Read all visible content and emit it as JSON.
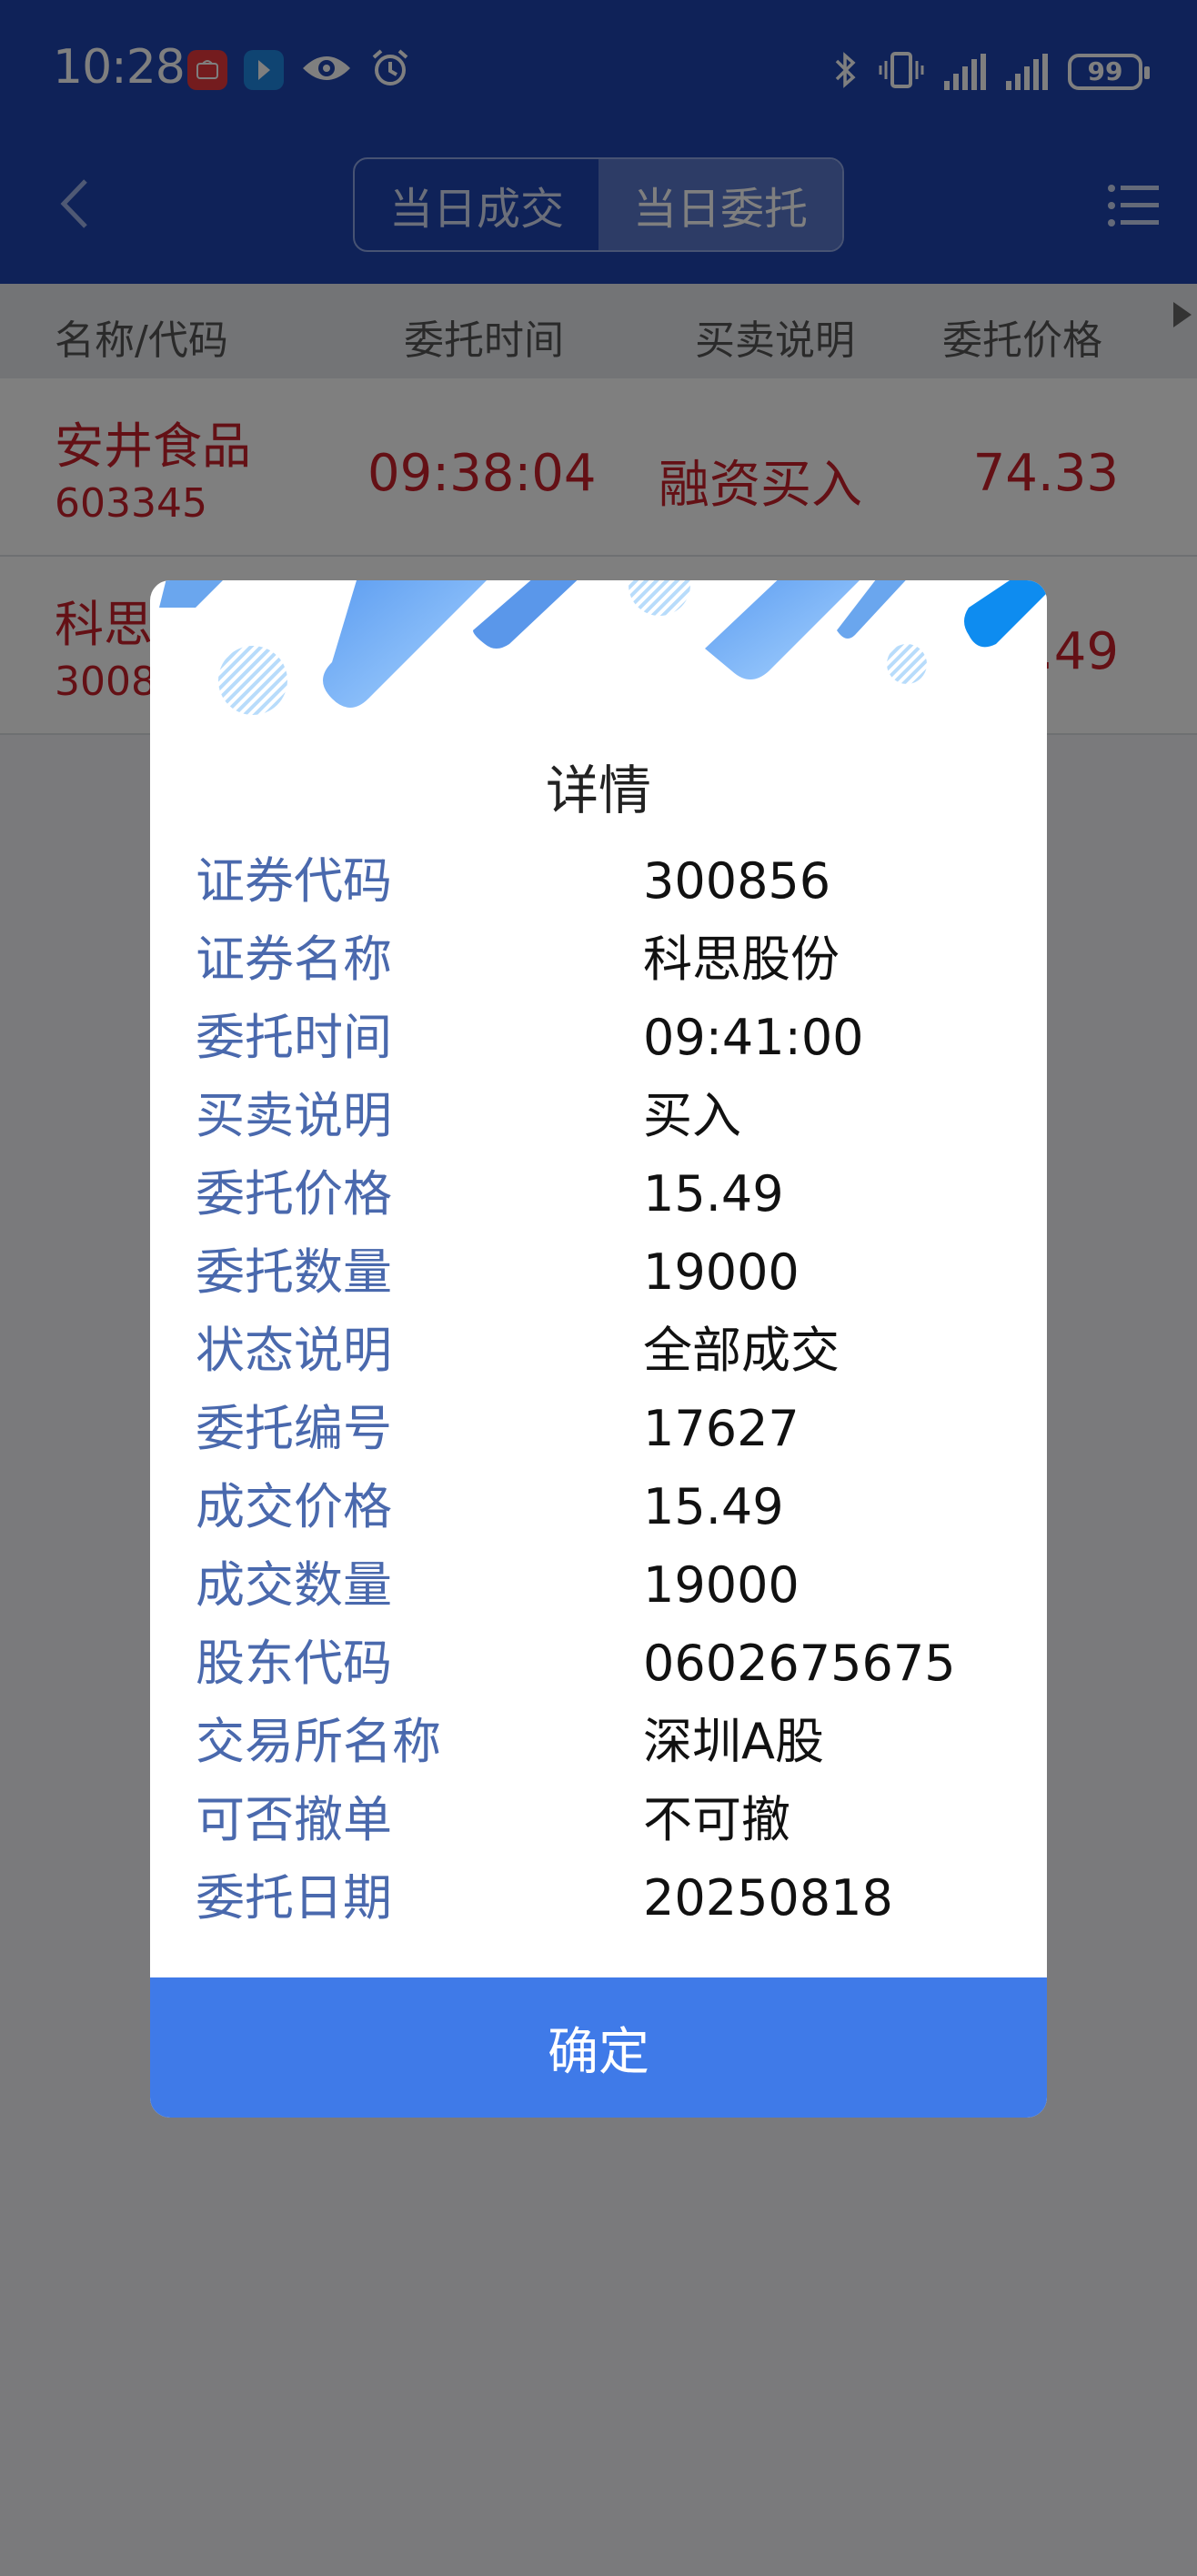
{
  "status_bar": {
    "time": "10:28",
    "battery": "99",
    "icons": [
      "huawei-app-icon",
      "arrow-app-icon",
      "eye-icon",
      "alarm-icon",
      "bluetooth-icon",
      "vibrate-icon",
      "signal-icon",
      "signal-icon"
    ]
  },
  "nav": {
    "tabs": [
      {
        "label": "当日成交",
        "active": false
      },
      {
        "label": "当日委托",
        "active": true
      }
    ]
  },
  "table": {
    "columns": [
      "名称/代码",
      "委托时间",
      "买卖说明",
      "委托价格"
    ],
    "rows": [
      {
        "name": "安井食品",
        "code": "603345",
        "time": "09:38:04",
        "note": "融资买入",
        "price": "74.33"
      },
      {
        "name": "科思",
        "code": "3008",
        "time": "",
        "note": "",
        "price": ".49"
      }
    ]
  },
  "dialog": {
    "title": "详情",
    "fields": [
      {
        "label": "证券代码",
        "value": "300856"
      },
      {
        "label": "证券名称",
        "value": "科思股份"
      },
      {
        "label": "委托时间",
        "value": "09:41:00"
      },
      {
        "label": "买卖说明",
        "value": "买入"
      },
      {
        "label": "委托价格",
        "value": "15.49"
      },
      {
        "label": "委托数量",
        "value": "19000"
      },
      {
        "label": "状态说明",
        "value": "全部成交"
      },
      {
        "label": "委托编号",
        "value": "17627"
      },
      {
        "label": "成交价格",
        "value": "15.49"
      },
      {
        "label": "成交数量",
        "value": "19000"
      },
      {
        "label": "股东代码",
        "value": "0602675675"
      },
      {
        "label": "交易所名称",
        "value": "深圳A股"
      },
      {
        "label": "可否撤单",
        "value": "不可撤"
      },
      {
        "label": "委托日期",
        "value": "20250818"
      }
    ],
    "confirm_label": "确定"
  },
  "colors": {
    "header_blue": "#1f44b0",
    "accent_red": "#c8202a",
    "label_blue": "#4a69ad",
    "button_blue": "#3f7ae8"
  }
}
